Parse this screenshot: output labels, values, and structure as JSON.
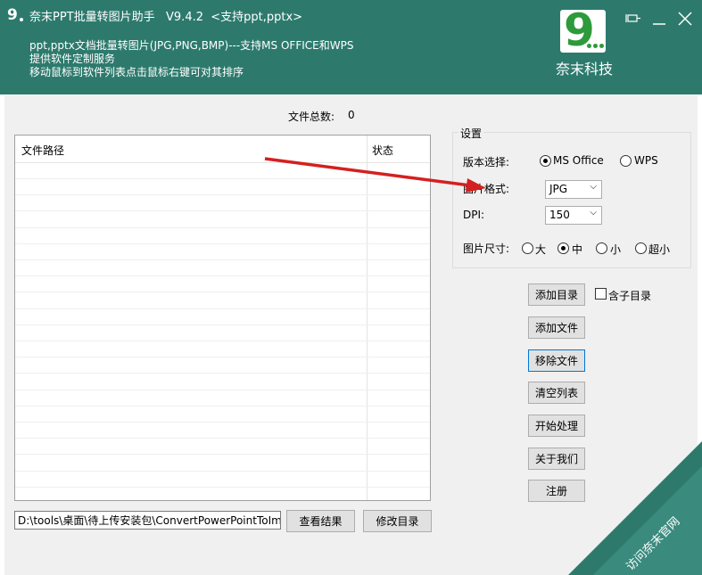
{
  "header": {
    "title": "奈末PPT批量转图片助手   V9.4.2  <支持ppt,pptx>",
    "desc_lines": [
      "ppt,pptx文档批量转图片(JPG,PNG,BMP)---支持MS OFFICE和WPS",
      "提供软件定制服务",
      "移动鼠标到软件列表点击鼠标右键可对其排序"
    ],
    "brand_logo_text": "9",
    "brand_name": "奈末科技",
    "controls": {
      "pin": "⊣⊏",
      "minimize": "—",
      "close": "✕"
    }
  },
  "file_count": {
    "label": "文件总数:",
    "value": "0"
  },
  "list": {
    "columns": [
      "文件路径",
      "状态"
    ],
    "rows": []
  },
  "settings": {
    "legend": "设置",
    "version_label": "版本选择:",
    "version_options": [
      "MS Office",
      "WPS"
    ],
    "version_selected": "MS Office",
    "format_label": "图片格式:",
    "format_value": "JPG",
    "dpi_label": "DPI:",
    "dpi_value": "150",
    "size_label": "图片尺寸:",
    "size_options": [
      "大",
      "中",
      "小",
      "超小"
    ],
    "size_selected": "中"
  },
  "buttons": {
    "add_dir": "添加目录",
    "include_subdir": "含子目录",
    "include_subdir_checked": false,
    "add_file": "添加文件",
    "remove_file": "移除文件",
    "clear_list": "清空列表",
    "start": "开始处理",
    "about": "关于我们",
    "register": "注册",
    "view_result": "查看结果",
    "change_dir": "修改目录"
  },
  "output_path": "D:\\tools\\桌面\\待上传安装包\\ConvertPowerPointToIma",
  "corner_ribbon": "访问奈末官网",
  "colors": {
    "header_bg": "#2d7a6d",
    "brand_green": "#2d9a3c",
    "arrow_red": "#d42020",
    "ribbon": "#2d7a6d"
  }
}
